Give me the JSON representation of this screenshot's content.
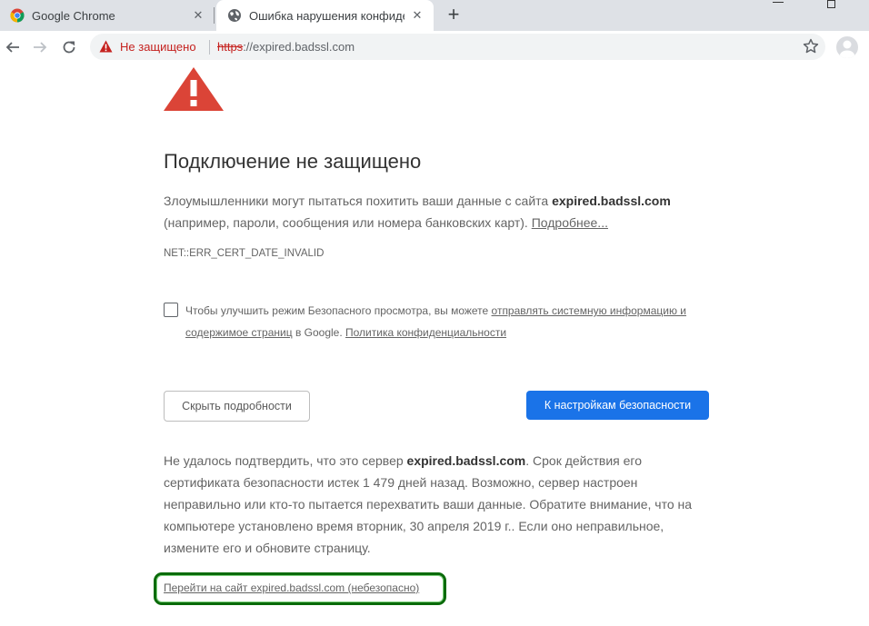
{
  "tabs": [
    {
      "title": "Google Chrome",
      "favicon": "chrome-icon"
    },
    {
      "title": "Ошибка нарушения конфиденц...",
      "favicon": "globe-icon",
      "close": "✕"
    }
  ],
  "tab_close_glyph": "✕",
  "new_tab_glyph": "+",
  "omnibox": {
    "security_label": "Не защищено",
    "url_scheme": "https",
    "url_rest": "://expired.badssl.com"
  },
  "interstitial": {
    "heading": "Подключение не защищено",
    "p1_before": "Злоумышленники могут пытаться похитить ваши данные с сайта ",
    "p1_host": "expired.badssl.com",
    "p1_after": " (например, пароли, сообщения или номера банковских карт). ",
    "learn_more": "Подробнее...",
    "error_code": "NET::ERR_CERT_DATE_INVALID",
    "checkbox_text": "Чтобы улучшить режим Безопасного просмотра, вы можете ",
    "checkbox_link": "отправлять системную информацию и содержимое страниц",
    "checkbox_mid": " в Google. ",
    "privacy_link": "Политика конфиденциальности",
    "details_button": "Скрыть подробности",
    "back_button": "К настройкам безопасности",
    "p2_before": "Не удалось подтвердить, что это сервер ",
    "p2_host": "expired.badssl.com",
    "p2_after": ". Срок действия его сертификата безопасности истек 1 479 дней назад. Возможно, сервер настроен неправильно или кто-то пытается перехватить ваши данные. Обратите внимание, что на компьютере установлено время вторник, 30 апреля 2019 г.. Если оно неправильное, измените его и обновите страницу.",
    "proceed_link": "Перейти на сайт expired.badssl.com (небезопасно)"
  },
  "colors": {
    "warning_red": "#db4437",
    "not_secure_red": "#c5221f",
    "primary_blue": "#1a73e8",
    "highlight_green": "#0a6b0a"
  }
}
